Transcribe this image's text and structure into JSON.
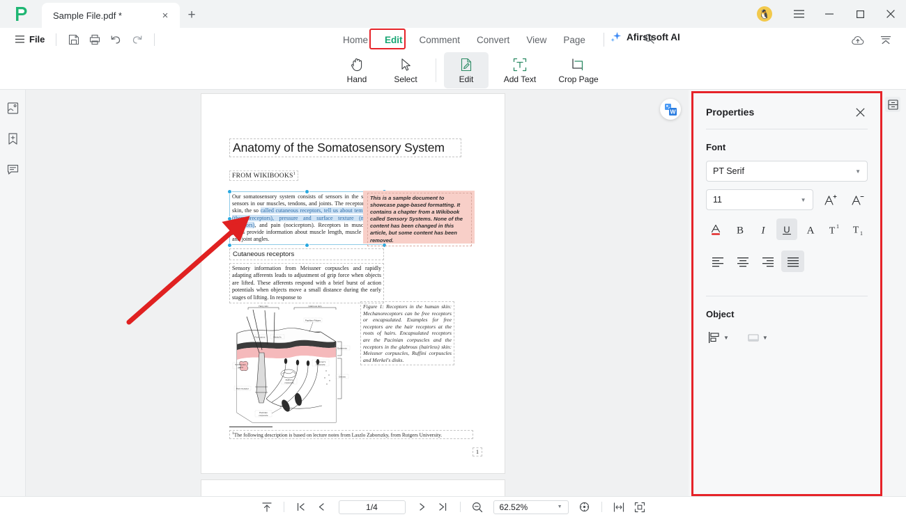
{
  "window": {
    "tab_title": "Sample File.pdf *",
    "new_tab_label": "+",
    "close_tab_label": "×",
    "minimize_label": "—",
    "maximize_label": "□",
    "close_label": "×",
    "avatar_glyph": "🐧"
  },
  "quickbar": {
    "file_label": "File",
    "icons": [
      "save-icon",
      "print-icon",
      "undo-icon",
      "redo-icon"
    ]
  },
  "menu": {
    "items": [
      {
        "label": "Home",
        "active": false
      },
      {
        "label": "Edit",
        "active": true
      },
      {
        "label": "Comment",
        "active": false
      },
      {
        "label": "Convert",
        "active": false
      },
      {
        "label": "View",
        "active": false
      },
      {
        "label": "Page",
        "active": false
      }
    ],
    "ai_label": "Afirstsoft AI",
    "search_icon": "search-icon",
    "right_icons": [
      "cloud-upload-icon",
      "collapse-ribbon-icon"
    ],
    "highlight_color": "#e62329"
  },
  "ribbon": {
    "tools": [
      {
        "label": "Hand",
        "icon": "hand-icon",
        "active": false
      },
      {
        "label": "Select",
        "icon": "cursor-icon",
        "active": false
      },
      {
        "label": "Edit",
        "icon": "edit-page-icon",
        "active": true
      },
      {
        "label": "Add Text",
        "icon": "add-text-icon",
        "active": false
      },
      {
        "label": "Crop Page",
        "icon": "crop-page-icon",
        "active": false
      }
    ]
  },
  "left_rail": {
    "items": [
      {
        "name": "thumbnails-icon"
      },
      {
        "name": "bookmarks-icon"
      },
      {
        "name": "comments-icon"
      }
    ]
  },
  "document": {
    "word_badge": "convert-to-word-icon",
    "title": "Anatomy of the Somatosensory System",
    "from_line": "FROM WIKIBOOKS",
    "from_sup": "1",
    "paragraph1_parts": {
      "plain1": "Our somatosensory system consists of sensors in the skin and sensors in our muscles, tendons, and joints. The receptors in the skin, the so ",
      "link1": "called cutaneous receptors, tell us about temperature (thermoreceptors), pressure and surface texture (mechano receptors)",
      "plain2": ", and pain (nociceptors). Receptors in muscles and joints provide information about muscle length, muscle tension, and joint angles."
    },
    "note_box": "This is a sample document to showcase page-based formatting. It contains a chapter from a Wikibook called Sensory Systems. None of the content has been changed in this article, but some content has been removed.",
    "section_heading": "Cutaneous receptors",
    "paragraph2": "Sensory information from Meissner corpuscles and rapidly adapting afferents leads to adjustment of grip force when objects are lifted. These afferents respond with a brief burst of action potentials when objects move a small distance during the early stages of lifting. In response to",
    "figure_caption": "Figure 1: Receptors in the human skin: Mechanoreceptors can be free receptors or encapsulated. Examples for free receptors are the hair receptors at the roots of hairs. Encapsulated receptors are the Pacinian corpuscles and the receptors in the glabrous (hairless) skin: Meissner corpuscles, Ruffini corpuscles and Merkel's disks.",
    "figure_labels": {
      "hairy_skin": "Hairy skin",
      "glabrous_skin": "Glabrous skin",
      "papillary_ridges": "Papillary Ridges",
      "septa": "Septa",
      "epidermis": "Epidermis",
      "dermis": "Dermis",
      "free_nerve": "Free nerve ending",
      "merkel": "Merkel's receptor",
      "meissner": "Meissner's corpuscle",
      "ruffini": "Ruffini corpuscle",
      "sebaceous": "Sebaceous gland",
      "hair_receptor": "Hair receptor",
      "pacinian": "Pacinian corpuscle"
    },
    "footnote_sup": "1",
    "footnote": "The following description is based on lecture notes from Laszlo Zaborszky, from Rutgers University.",
    "page_number": "1",
    "selection_color": "#29a8e0"
  },
  "properties": {
    "title": "Properties",
    "close_icon": "close-icon",
    "font_section_label": "Font",
    "font_family": "PT Serif",
    "font_size": "11",
    "increase_size_icon": "increase-font-size-icon",
    "decrease_size_icon": "decrease-font-size-icon",
    "format_buttons": [
      {
        "name": "font-color-button",
        "glyph": "A",
        "active": false
      },
      {
        "name": "bold-button",
        "glyph": "B",
        "active": false
      },
      {
        "name": "italic-button",
        "glyph": "I",
        "active": false
      },
      {
        "name": "underline-button",
        "glyph": "U",
        "active": true
      },
      {
        "name": "strikethrough-button",
        "glyph": "A",
        "active": false
      },
      {
        "name": "superscript-button",
        "glyph": "T",
        "active": false
      },
      {
        "name": "subscript-button",
        "glyph": "T",
        "active": false
      }
    ],
    "align_buttons": [
      {
        "name": "align-left-button",
        "active": false
      },
      {
        "name": "align-center-button",
        "active": false
      },
      {
        "name": "align-right-button",
        "active": false
      },
      {
        "name": "align-justify-button",
        "active": true
      }
    ],
    "object_section_label": "Object",
    "object_buttons": [
      {
        "name": "align-objects-button"
      },
      {
        "name": "object-fill-button"
      }
    ],
    "highlight_color": "#e62329",
    "font_color_swatch": "#e02020"
  },
  "panel_toggle": {
    "icon": "toggle-properties-panel-icon"
  },
  "statusbar": {
    "fit_top_icon": "scroll-to-top-icon",
    "first_page_icon": "first-page-icon",
    "prev_page_icon": "previous-page-icon",
    "page_value": "1/4",
    "next_page_icon": "next-page-icon",
    "last_page_icon": "last-page-icon",
    "zoom_out_icon": "zoom-out-icon",
    "zoom_value": "62.52%",
    "zoom_in_icon": "zoom-in-icon",
    "fit_width_icon": "fit-width-icon",
    "fit_page_icon": "fit-page-icon"
  }
}
